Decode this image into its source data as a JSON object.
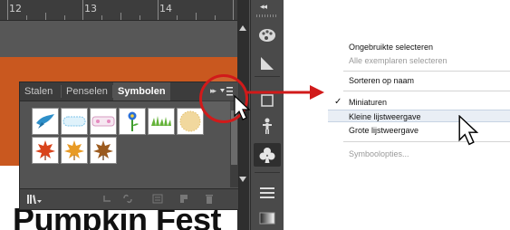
{
  "ruler": {
    "ticks": [
      "12",
      "13",
      "14"
    ]
  },
  "document": {
    "headline": "Pumpkin Fest"
  },
  "panel": {
    "tabs": [
      "Stalen",
      "Penselen",
      "Symbolen"
    ],
    "active_tab": "Symbolen",
    "thumbnails": [
      "bird",
      "cloud-banner",
      "flower-banner",
      "blue-flower",
      "grass",
      "dotted-circle",
      "maple-leaf-red",
      "maple-leaf-orange",
      "maple-leaf-brown"
    ],
    "bottom_icons": [
      "symbol-library-menu-icon",
      "place-symbol-icon",
      "break-link-icon",
      "symbol-options-icon",
      "new-symbol-icon",
      "delete-symbol-icon"
    ]
  },
  "dock": {
    "icons": [
      "paintbrush-palette-icon",
      "gradient-triangle-icon",
      "puppet-icon",
      "club-symbol-icon",
      "stroke-lines-icon",
      "gradient-swatch-icon"
    ]
  },
  "menu": {
    "items": [
      {
        "label": "Ongebruikte selecteren",
        "disabled": false,
        "checked": false,
        "highlighted": false
      },
      {
        "label": "Alle exemplaren selecteren",
        "disabled": true,
        "checked": false,
        "highlighted": false
      },
      {
        "label": "Sorteren op naam",
        "disabled": false,
        "checked": false,
        "highlighted": false
      },
      {
        "label": "Miniaturen",
        "disabled": false,
        "checked": true,
        "highlighted": false
      },
      {
        "label": "Kleine lijstweergave",
        "disabled": false,
        "checked": false,
        "highlighted": true
      },
      {
        "label": "Grote lijstweergave",
        "disabled": false,
        "checked": false,
        "highlighted": false
      },
      {
        "label": "Symboolopties...",
        "disabled": true,
        "checked": false,
        "highlighted": false
      }
    ]
  },
  "colors": {
    "accent_red": "#d11a1a",
    "canvas_orange": "#c9581f",
    "panel_gray": "#535353"
  }
}
